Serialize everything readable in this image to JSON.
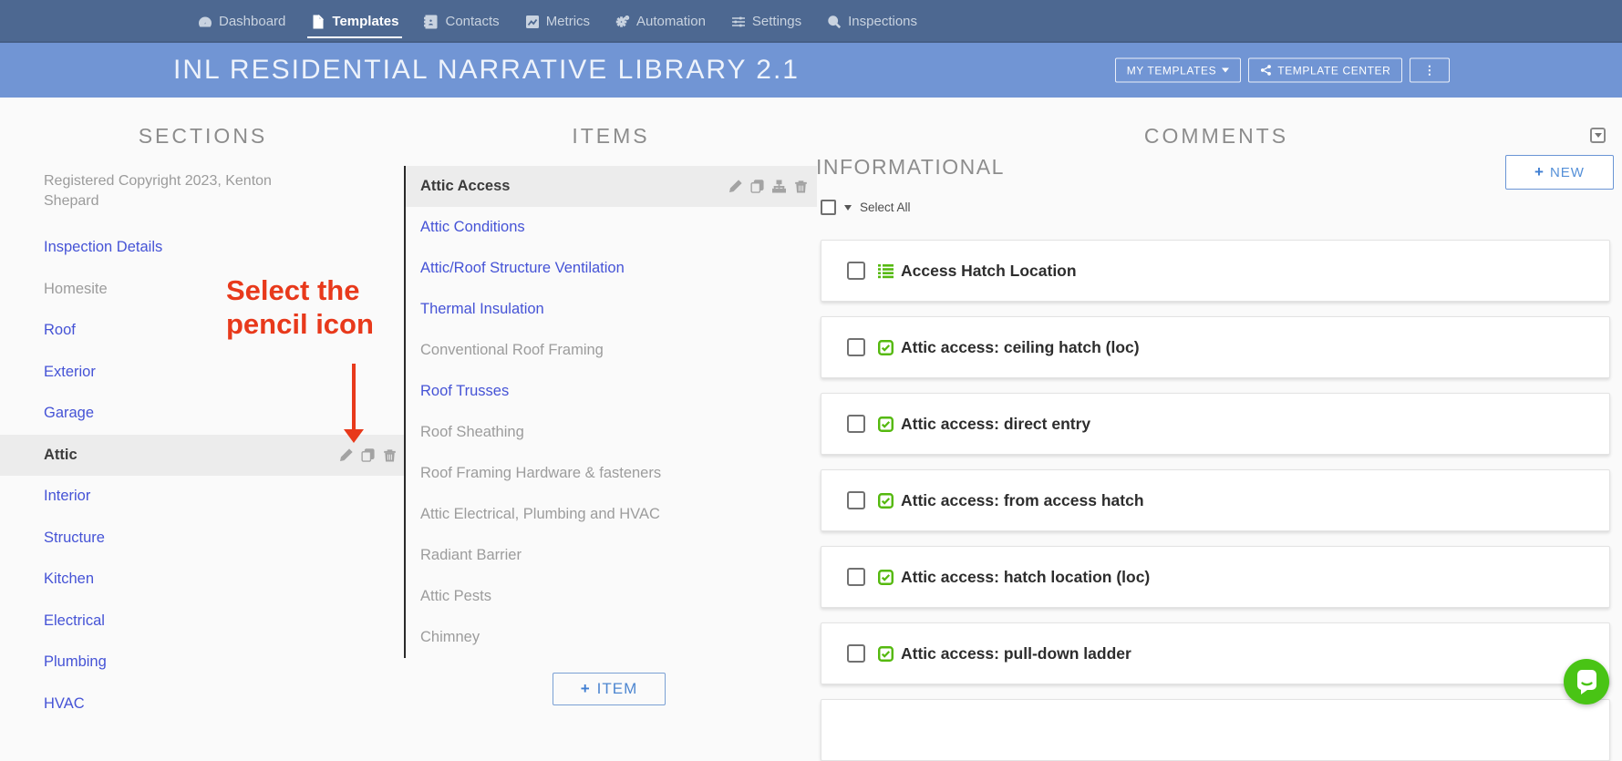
{
  "nav": {
    "items": [
      {
        "label": "Dashboard",
        "icon": "dashboard-gauge-icon",
        "active": false
      },
      {
        "label": "Templates",
        "icon": "template-file-icon",
        "active": true
      },
      {
        "label": "Contacts",
        "icon": "address-book-icon",
        "active": false
      },
      {
        "label": "Metrics",
        "icon": "chart-line-icon",
        "active": false
      },
      {
        "label": "Automation",
        "icon": "gears-icon",
        "active": false
      },
      {
        "label": "Settings",
        "icon": "sliders-icon",
        "active": false
      },
      {
        "label": "Inspections",
        "icon": "magnifier-icon",
        "active": false
      }
    ]
  },
  "header": {
    "title": "INL RESIDENTIAL NARRATIVE LIBRARY 2.1",
    "my_templates_label": "MY TEMPLATES",
    "template_center_label": "TEMPLATE CENTER",
    "more_label": "⋮"
  },
  "sections": {
    "heading": "SECTIONS",
    "copyright": "Registered Copyright 2023, Kenton Shepard",
    "items": [
      {
        "label": "Inspection Details",
        "style": "link"
      },
      {
        "label": "Homesite",
        "style": "plain"
      },
      {
        "label": "Roof",
        "style": "link"
      },
      {
        "label": "Exterior",
        "style": "link"
      },
      {
        "label": "Garage",
        "style": "link"
      },
      {
        "label": "Attic",
        "style": "selected",
        "row_icons": [
          "pencil-icon",
          "copy-icon",
          "trash-icon"
        ]
      },
      {
        "label": "Interior",
        "style": "link"
      },
      {
        "label": "Structure",
        "style": "link"
      },
      {
        "label": "Kitchen",
        "style": "link"
      },
      {
        "label": "Electrical",
        "style": "link"
      },
      {
        "label": "Plumbing",
        "style": "link"
      },
      {
        "label": "HVAC",
        "style": "link"
      }
    ]
  },
  "annotation": {
    "line1": "Select the",
    "line2": "pencil icon",
    "color": "#e8391b"
  },
  "items_panel": {
    "heading": "ITEMS",
    "items": [
      {
        "label": "Attic Access",
        "style": "selected",
        "row_icons": [
          "pencil-icon",
          "copy-icon",
          "sitemap-icon",
          "trash-icon"
        ]
      },
      {
        "label": "Attic Conditions",
        "style": "link"
      },
      {
        "label": "Attic/Roof Structure Ventilation",
        "style": "link"
      },
      {
        "label": "Thermal Insulation",
        "style": "link"
      },
      {
        "label": "Conventional Roof Framing",
        "style": "plain"
      },
      {
        "label": "Roof Trusses",
        "style": "link"
      },
      {
        "label": "Roof Sheathing",
        "style": "plain"
      },
      {
        "label": "Roof Framing Hardware & fasteners",
        "style": "plain"
      },
      {
        "label": "Attic Electrical, Plumbing and HVAC",
        "style": "plain"
      },
      {
        "label": "Radiant Barrier",
        "style": "plain"
      },
      {
        "label": "Attic Pests",
        "style": "plain"
      },
      {
        "label": "Chimney",
        "style": "plain"
      }
    ],
    "add_button": {
      "plus": "+",
      "label": "ITEM"
    }
  },
  "comments": {
    "heading": "COMMENTS",
    "group_heading": "INFORMATIONAL",
    "new_button": {
      "plus": "+",
      "label": "NEW"
    },
    "select_all_label": "Select All",
    "cards": [
      {
        "label": "Access Hatch Location",
        "icon": "list-icon",
        "checked": false
      },
      {
        "label": "Attic access: ceiling hatch (loc)",
        "icon": "check-square-icon",
        "checked": false
      },
      {
        "label": "Attic access: direct entry",
        "icon": "check-square-icon",
        "checked": false
      },
      {
        "label": "Attic access: from access hatch",
        "icon": "check-square-icon",
        "checked": false
      },
      {
        "label": "Attic access: hatch location (loc)",
        "icon": "check-square-icon",
        "checked": false
      },
      {
        "label": "Attic access: pull-down ladder",
        "icon": "check-square-icon",
        "checked": false
      }
    ]
  },
  "colors": {
    "nav_bg": "#4d6891",
    "header_bg": "#7195d4",
    "link_blue": "#4553d6",
    "annotation_red": "#e8391b",
    "icon_green": "#55b90f",
    "chat_green": "#49c415",
    "button_blue": "#4d86d0"
  }
}
